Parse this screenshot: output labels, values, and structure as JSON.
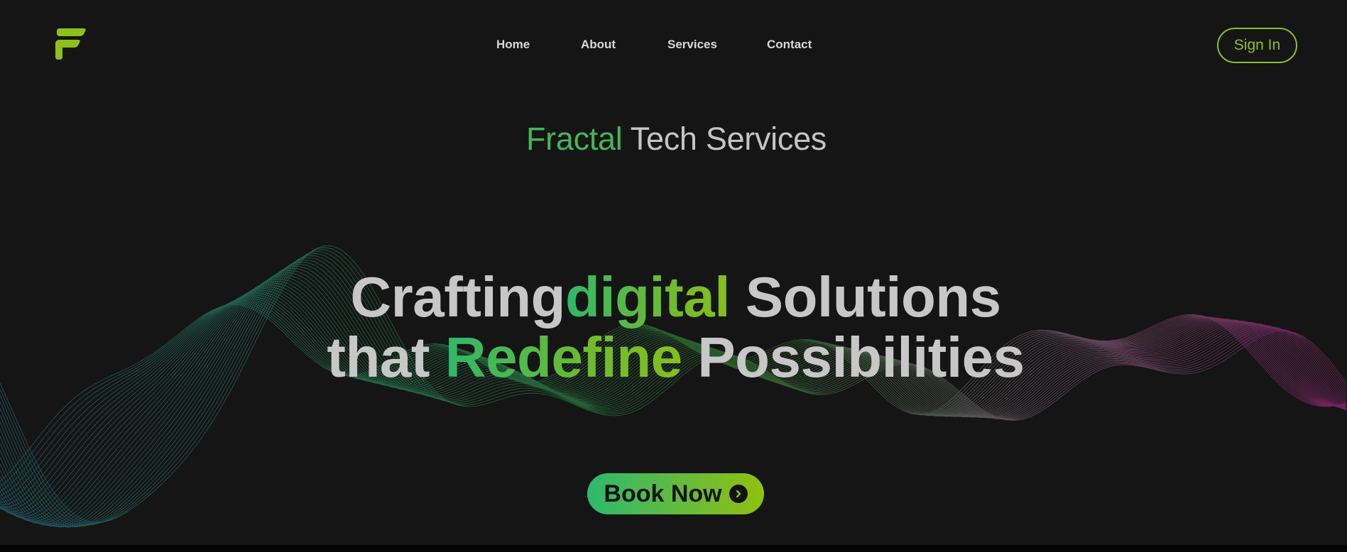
{
  "nav": {
    "items": [
      {
        "label": "Home"
      },
      {
        "label": "About"
      },
      {
        "label": "Services"
      },
      {
        "label": "Contact"
      }
    ],
    "sign_in_label": "Sign In"
  },
  "brand": {
    "accent": "Fractal",
    "rest": "Tech Services"
  },
  "hero": {
    "line1": {
      "part1": "Crafting",
      "accent": "digital",
      "part2": "Solutions"
    },
    "line2": {
      "part1": "that",
      "accent": "Redefine",
      "part2": "Possibilities"
    },
    "cta_label": "Book Now"
  },
  "colors": {
    "background": "#151515",
    "accent_green": "#8cc11a",
    "accent_teal": "#2fb86a",
    "text_light": "#c7c7c7"
  },
  "icons": {
    "logo": "fractal-f-logo",
    "cta": "chevron-right-circle-icon"
  }
}
